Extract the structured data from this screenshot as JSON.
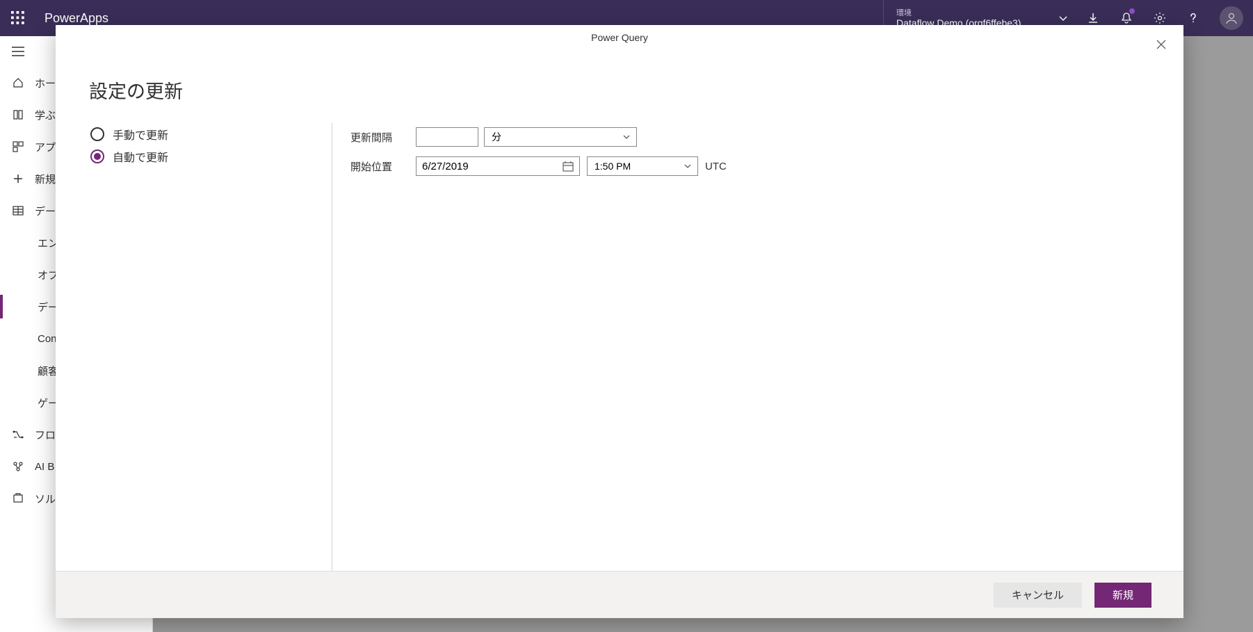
{
  "header": {
    "brand": "PowerApps",
    "env_label": "環境",
    "env_name": "Dataflow Demo (orgf6ffebe3)"
  },
  "sidebar": {
    "items": [
      {
        "label": "ホー"
      },
      {
        "label": "学ぶ"
      },
      {
        "label": "アプ"
      },
      {
        "label": "新規"
      },
      {
        "label": "デー"
      },
      {
        "label": "エン"
      },
      {
        "label": "オプ"
      },
      {
        "label": "デー"
      },
      {
        "label": "Con"
      },
      {
        "label": "顧客"
      },
      {
        "label": "ゲー"
      },
      {
        "label": "フロ"
      },
      {
        "label": "AI B"
      },
      {
        "label": "ソル"
      }
    ]
  },
  "dialog": {
    "tab_title": "Power Query",
    "title": "設定の更新",
    "radio_manual": "手動で更新",
    "radio_auto": "自動で更新",
    "label_interval": "更新間隔",
    "interval_value": "",
    "unit_selected": "分",
    "label_start": "開始位置",
    "start_date": "6/27/2019",
    "start_time": "1:50 PM",
    "tz": "UTC",
    "cancel": "キャンセル",
    "submit": "新規"
  }
}
